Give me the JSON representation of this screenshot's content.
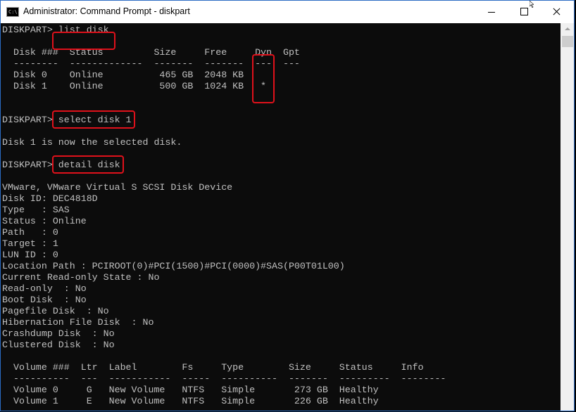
{
  "window": {
    "title": "Administrator: Command Prompt - diskpart",
    "app_icon_text": "C:\\."
  },
  "console": {
    "lines": [
      "DISKPART> list disk",
      "",
      "  Disk ###  Status         Size     Free     Dyn  Gpt",
      "  --------  -------------  -------  -------  ---  ---",
      "  Disk 0    Online          465 GB  2048 KB",
      "  Disk 1    Online          500 GB  1024 KB   *",
      "",
      "DISKPART> select disk 1",
      "",
      "Disk 1 is now the selected disk.",
      "",
      "DISKPART> detail disk",
      "",
      "VMware, VMware Virtual S SCSI Disk Device",
      "Disk ID: DEC4818D",
      "Type   : SAS",
      "Status : Online",
      "Path   : 0",
      "Target : 1",
      "LUN ID : 0",
      "Location Path : PCIROOT(0)#PCI(1500)#PCI(0000)#SAS(P00T01L00)",
      "Current Read-only State : No",
      "Read-only  : No",
      "Boot Disk  : No",
      "Pagefile Disk  : No",
      "Hibernation File Disk  : No",
      "Crashdump Disk  : No",
      "Clustered Disk  : No",
      "",
      "  Volume ###  Ltr  Label        Fs     Type        Size     Status     Info",
      "  ----------  ---  -----------  -----  ----------  -------  ---------  --------",
      "  Volume 0     G   New Volume   NTFS   Simple       273 GB  Healthy",
      "  Volume 1     E   New Volume   NTFS   Simple       226 GB  Healthy"
    ]
  },
  "highlights": [
    "list-disk-command",
    "dyn-column",
    "select-disk-command",
    "detail-disk-command"
  ]
}
